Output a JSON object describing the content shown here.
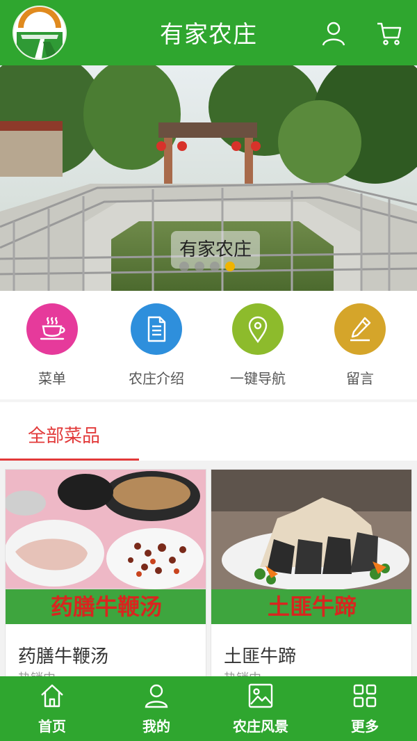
{
  "header": {
    "title": "有家农庄",
    "user_icon": "user-icon",
    "cart_icon": "cart-icon"
  },
  "banner": {
    "caption": "有家农庄",
    "dot_count": 4,
    "active_dot": 4
  },
  "quick_menu": [
    {
      "label": "菜单",
      "icon": "coffee-cup-icon",
      "color": "#e63a9b"
    },
    {
      "label": "农庄介绍",
      "icon": "document-icon",
      "color": "#2e8fdc"
    },
    {
      "label": "一键导航",
      "icon": "location-pin-icon",
      "color": "#8dbb2c"
    },
    {
      "label": "留言",
      "icon": "pencil-icon",
      "color": "#d5a52a"
    }
  ],
  "section": {
    "title": "全部菜品"
  },
  "products": [
    {
      "name": "药膳牛鞭汤",
      "image_text": "药膳牛鞭汤",
      "subtitle": "热销中"
    },
    {
      "name": "土匪牛蹄",
      "image_text": "土匪牛蹄",
      "subtitle": "热销中"
    }
  ],
  "bottom_nav": [
    {
      "label": "首页",
      "icon": "home-icon"
    },
    {
      "label": "我的",
      "icon": "user-icon"
    },
    {
      "label": "农庄风景",
      "icon": "picture-icon"
    },
    {
      "label": "更多",
      "icon": "grid-icon"
    }
  ],
  "colors": {
    "brand_green": "#2fa62f",
    "section_red": "#e23a3a",
    "dot_active": "#f0b400"
  }
}
